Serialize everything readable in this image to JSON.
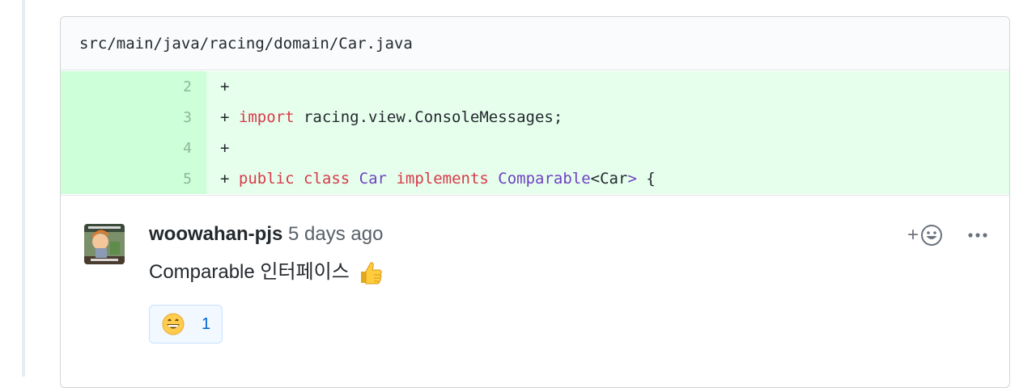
{
  "file": {
    "path": "src/main/java/racing/domain/Car.java"
  },
  "diff": {
    "lines": [
      {
        "number": "2",
        "marker": "+",
        "tokens": []
      },
      {
        "number": "3",
        "marker": "+",
        "tokens": [
          {
            "text": "import",
            "kind": "kw"
          },
          {
            "text": " racing.view.ConsoleMessages;",
            "kind": "plain"
          }
        ]
      },
      {
        "number": "4",
        "marker": "+",
        "tokens": []
      },
      {
        "number": "5",
        "marker": "+",
        "tokens": [
          {
            "text": "public",
            "kind": "kw"
          },
          {
            "text": " ",
            "kind": "plain"
          },
          {
            "text": "class",
            "kind": "kw"
          },
          {
            "text": " ",
            "kind": "plain"
          },
          {
            "text": "Car",
            "kind": "type"
          },
          {
            "text": " ",
            "kind": "plain"
          },
          {
            "text": "implements",
            "kind": "kw"
          },
          {
            "text": " ",
            "kind": "plain"
          },
          {
            "text": "Comparable",
            "kind": "type"
          },
          {
            "text": "<Car",
            "kind": "plain"
          },
          {
            "text": ">",
            "kind": "type"
          },
          {
            "text": " {",
            "kind": "plain"
          }
        ]
      }
    ],
    "colors": {
      "keyword": "#d73a49",
      "type": "#6f42c1",
      "added_line_bg": "#e6ffed",
      "added_number_bg": "#cdffd8"
    }
  },
  "comment": {
    "author": "woowahan-pjs",
    "timestamp": "5 days ago",
    "body": "Comparable 인터페이스",
    "body_emoji": "thumbs-up-icon",
    "avatar_icon": "avatar-meme-icon",
    "add_reaction_label": "+",
    "add_reaction_icon": "smiley-icon",
    "more_icon": "kebab-horizontal-icon",
    "reactions": [
      {
        "emoji": "grinning-face-icon",
        "count": "1"
      }
    ]
  }
}
